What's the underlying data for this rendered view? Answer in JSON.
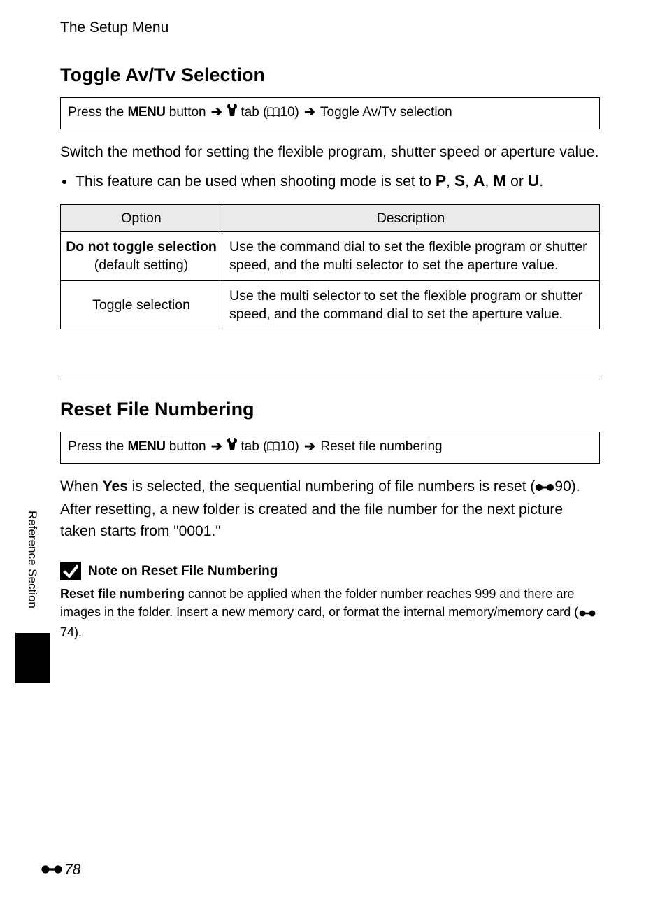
{
  "chapter": "The Setup Menu",
  "section1": {
    "title": "Toggle Av/Tv Selection",
    "nav": {
      "pre": "Press the ",
      "menu": "MENU",
      "mid1": " button ",
      "mid2": " tab (",
      "pageref": "10",
      "mid3": ") ",
      "dest": " Toggle Av/Tv selection"
    },
    "intro": "Switch the method for setting the flexible program, shutter speed or aperture value.",
    "bullet_pre": "This feature can be used when shooting mode is set to ",
    "modes": [
      "P",
      "S",
      "A",
      "M",
      "U"
    ],
    "bullet_post": ".",
    "table": {
      "headers": [
        "Option",
        "Description"
      ],
      "rows": [
        {
          "opt_line1": "Do not toggle selection",
          "opt_line2": "(default setting)",
          "desc": "Use the command dial to set the flexible program or shutter speed, and the multi selector to set the aperture value."
        },
        {
          "opt_line1": "Toggle selection",
          "opt_line2": "",
          "desc": "Use the multi selector to set the flexible program or shutter speed, and the command dial to set the aperture value."
        }
      ]
    }
  },
  "section2": {
    "title": "Reset File Numbering",
    "nav": {
      "pre": "Press the ",
      "menu": "MENU",
      "mid1": " button ",
      "mid2": " tab (",
      "pageref": "10",
      "mid3": ") ",
      "dest": " Reset file numbering"
    },
    "body_a": "When ",
    "body_yes": "Yes",
    "body_b": " is selected, the sequential numbering of file numbers is reset (",
    "body_ref": "90",
    "body_c": "). After resetting, a new folder is created and  the file number for the next picture taken starts from \"0001.\"",
    "note": {
      "title": "Note on Reset File Numbering",
      "lead": "Reset file numbering",
      "body_a": " cannot be applied when the folder number reaches 999 and there are images in the folder. Insert a new memory card, or format the internal memory/memory card (",
      "ref": "74",
      "body_b": ")."
    }
  },
  "side_label": "Reference Section",
  "page_number": "78"
}
